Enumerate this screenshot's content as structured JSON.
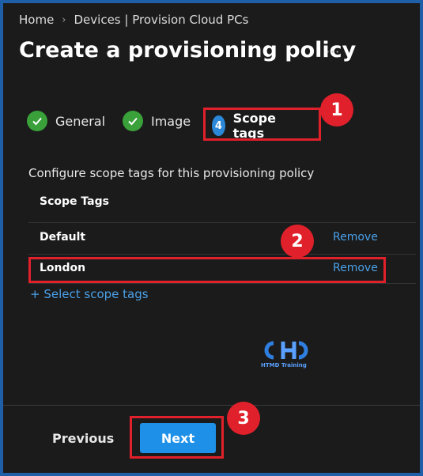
{
  "breadcrumb": {
    "home": "Home",
    "devices": "Devices | Provision Cloud PCs",
    "separator": "›"
  },
  "page": {
    "title": "Create a provisioning policy",
    "more": "···"
  },
  "steps": [
    {
      "label": "General",
      "state": "complete"
    },
    {
      "label": "Image",
      "state": "complete"
    },
    {
      "number": "4",
      "label": "Scope tags",
      "state": "active"
    }
  ],
  "content": {
    "description": "Configure scope tags for this provisioning policy",
    "column_header": "Scope Tags",
    "rows": [
      {
        "name": "Default",
        "action": "Remove"
      },
      {
        "name": "London",
        "action": "Remove"
      }
    ],
    "select_link": "+ Select scope tags"
  },
  "watermark": {
    "text": "HTMD Training"
  },
  "annotations": [
    "1",
    "2",
    "3"
  ],
  "footer": {
    "previous": "Previous",
    "next": "Next"
  },
  "colors": {
    "accent": "#1e90e8",
    "link": "#4aa0e8",
    "annotation": "#e0202a",
    "check": "#3aa13a",
    "frame": "#1f5fa8"
  }
}
